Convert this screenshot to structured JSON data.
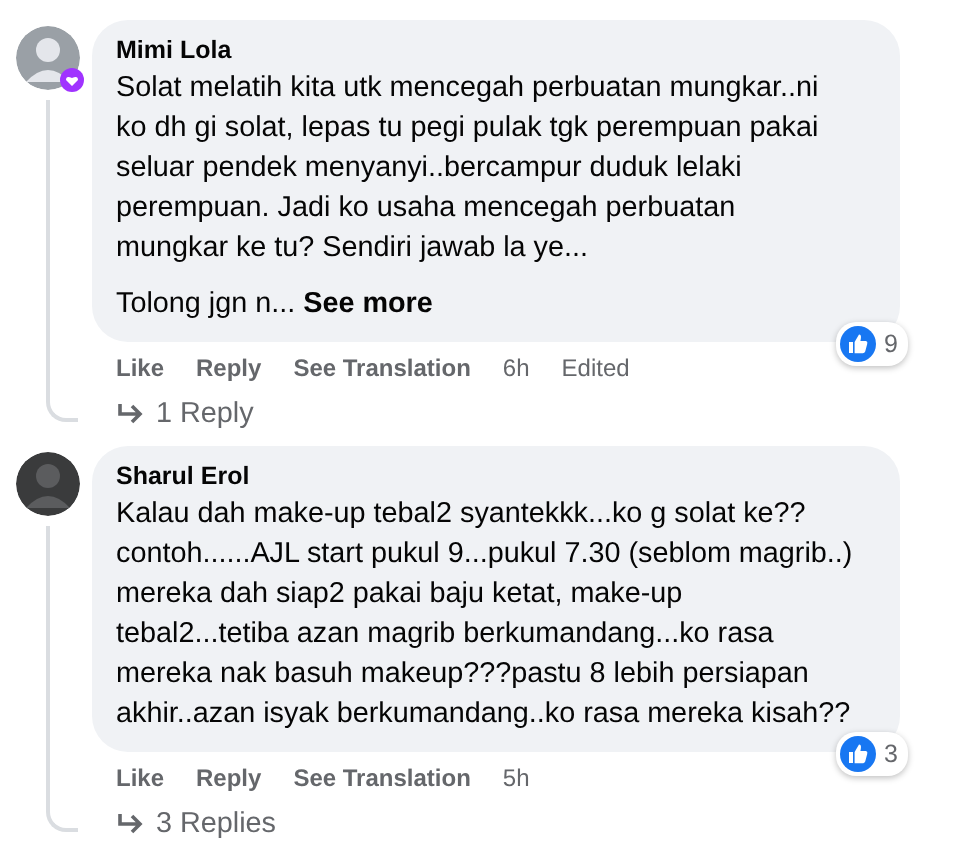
{
  "comments": [
    {
      "author": "Mimi Lola",
      "top_fan_badge": true,
      "text": "Solat melatih kita utk mencegah perbuatan mungkar..ni\nko dh gi solat, lepas tu pegi pulak tgk perempuan pakai\nseluar pendek menyanyi..bercampur duduk lelaki\nperempuan. Jadi ko usaha mencegah perbuatan\nmungkar ke tu? Sendiri jawab la ye...",
      "truncated": "Tolong jgn n...",
      "see_more": "See more",
      "reaction_count": "9",
      "actions": [
        "Like",
        "Reply",
        "See Translation"
      ],
      "time": "6h",
      "edited": "Edited",
      "replies": "1 Reply"
    },
    {
      "author": "Sharul Erol",
      "top_fan_badge": false,
      "text": "Kalau dah make-up tebal2 syantekkk...ko g solat ke??\ncontoh......AJL start pukul 9...pukul 7.30 (seblom magrib..)\nmereka dah siap2 pakai baju ketat, make-up\ntebal2...tetiba azan magrib berkumandang...ko rasa\nmereka nak basuh makeup???pastu 8 lebih persiapan\nakhir..azan isyak berkumandang..ko rasa mereka kisah??",
      "reaction_count": "3",
      "actions": [
        "Like",
        "Reply",
        "See Translation"
      ],
      "time": "5h",
      "replies": "3 Replies"
    }
  ]
}
